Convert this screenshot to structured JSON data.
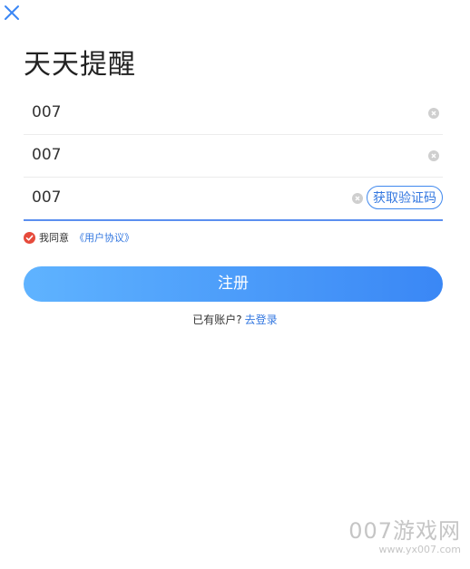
{
  "title": "天天提醒",
  "fields": [
    {
      "value": "007",
      "placeholder": ""
    },
    {
      "value": "007",
      "placeholder": ""
    },
    {
      "value": "007",
      "placeholder": ""
    }
  ],
  "get_code_label": "获取验证码",
  "agreement": {
    "text": "我同意",
    "link": "《用户协议》"
  },
  "register_label": "注册",
  "login": {
    "question": "已有账户?",
    "link": "去登录"
  },
  "watermark": {
    "brand": "007游戏网",
    "url": "www.yx007.com"
  },
  "colors": {
    "accent": "#3478e0",
    "button_start": "#5fb3ff",
    "button_end": "#3a87f5",
    "check": "#e64a3b"
  },
  "icons": [
    "close-icon",
    "clear-icon",
    "check-icon"
  ]
}
